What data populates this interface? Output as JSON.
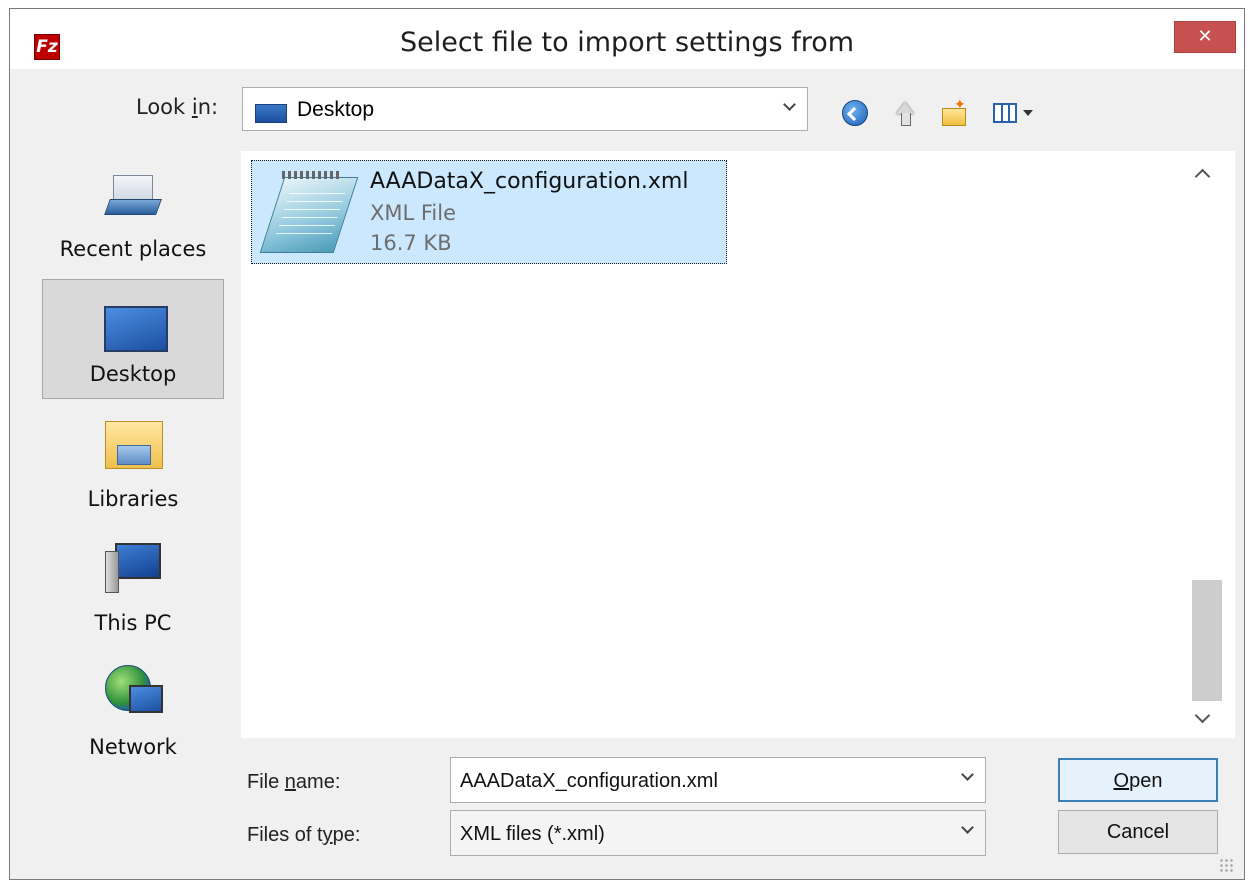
{
  "window": {
    "title": "Select file to import settings from",
    "app_icon_glyph": "Fz",
    "close_glyph": "✕"
  },
  "toolbar": {
    "look_in_label_pre": "Look ",
    "look_in_label_ul": "i",
    "look_in_label_post": "n:",
    "look_in_value": "Desktop",
    "icons": [
      "back-icon",
      "up-one-level-icon",
      "new-folder-icon",
      "view-menu-icon"
    ]
  },
  "places": [
    {
      "label": "Recent places",
      "icon": "recent-places-icon"
    },
    {
      "label": "Desktop",
      "icon": "desktop-icon",
      "selected": true
    },
    {
      "label": "Libraries",
      "icon": "libraries-icon"
    },
    {
      "label": "This PC",
      "icon": "this-pc-icon"
    },
    {
      "label": "Network",
      "icon": "network-icon"
    }
  ],
  "files": [
    {
      "name": "AAADataX_configuration.xml",
      "type": "XML File",
      "size": "16.7 KB",
      "selected": true
    }
  ],
  "form": {
    "file_name_label_pre": "File ",
    "file_name_label_ul": "n",
    "file_name_label_post": "ame:",
    "file_name_value": "AAADataX_configuration.xml",
    "file_type_label_pre": "Files of t",
    "file_type_label_ul": "y",
    "file_type_label_post": "pe:",
    "file_type_value": "XML files (*.xml)"
  },
  "buttons": {
    "open_ul": "O",
    "open_rest": "pen",
    "cancel": "Cancel"
  },
  "colors": {
    "selection": "#cce8ff",
    "close_button": "#c75050",
    "window_bg": "#f0f0f0"
  }
}
